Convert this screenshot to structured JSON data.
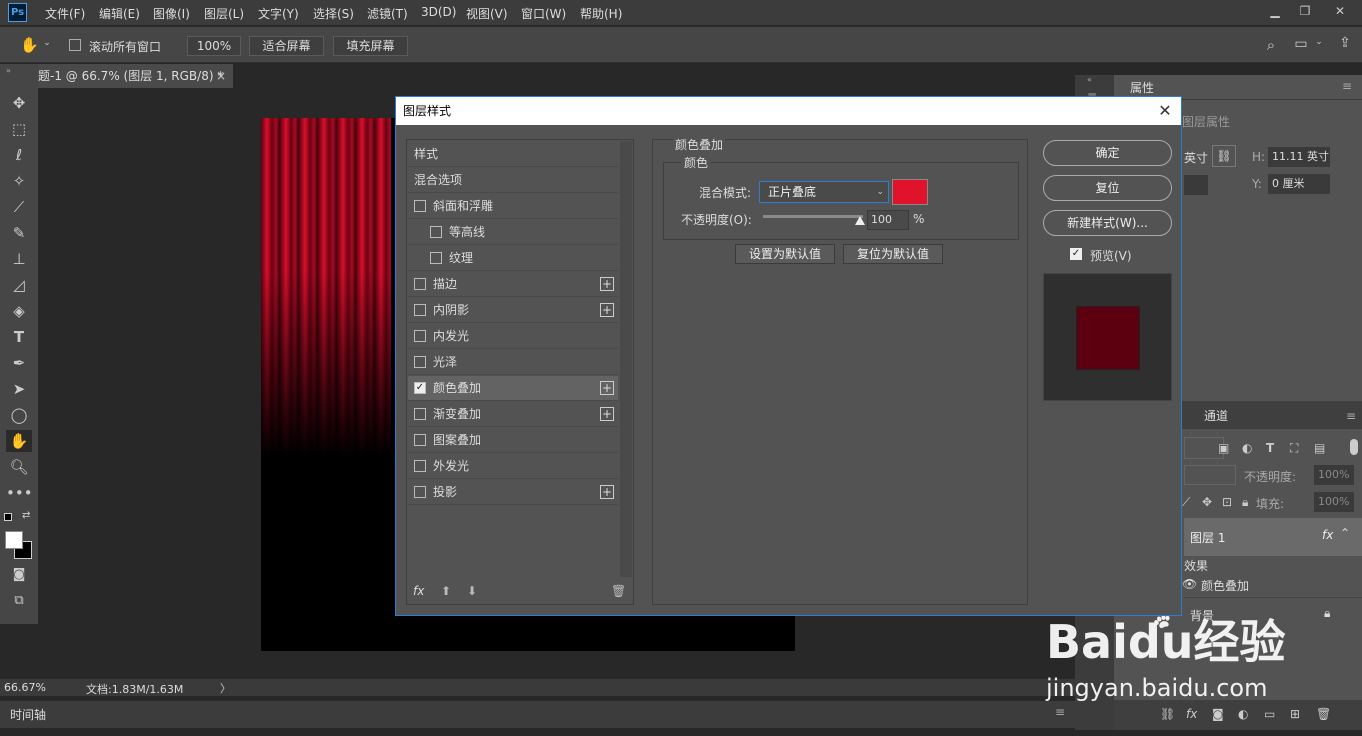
{
  "menubar": {
    "logo": "Ps",
    "items": [
      "文件(F)",
      "编辑(E)",
      "图像(I)",
      "图层(L)",
      "文字(Y)",
      "选择(S)",
      "滤镜(T)",
      "3D(D)",
      "视图(V)",
      "窗口(W)",
      "帮助(H)"
    ]
  },
  "options": {
    "scroll_all": "滚动所有窗口",
    "zoom": "100%",
    "fit_screen": "适合屏幕",
    "fill_screen": "填充屏幕"
  },
  "document": {
    "tab_title": "题-1 @ 66.7% (图层 1, RGB/8) *",
    "tab_close": "×"
  },
  "status": {
    "zoom": "66.67%",
    "doc_info": "文档:1.83M/1.63M",
    "arrow": "〉",
    "timeline": "时间轴"
  },
  "properties": {
    "tab": "属性",
    "subtitle": "图层属性",
    "w_unit": "英寸",
    "h_label": "H:",
    "h_value": "11.11 英寸",
    "y_label": "Y:",
    "y_value": "0 厘米"
  },
  "layers": {
    "tab_channels": "通道",
    "opacity_label": "不透明度:",
    "opacity_value": "100%",
    "fill_label": "填充:",
    "fill_value": "100%",
    "layer1": "图层 1",
    "fx": "fx",
    "effects": "效果",
    "effect_color_overlay": "颜色叠加",
    "background": "背景"
  },
  "dialog": {
    "title": "图层样式",
    "close": "✕",
    "styles": [
      {
        "label": "样式",
        "checkbox": false,
        "plus": false,
        "indent": false,
        "checked": false
      },
      {
        "label": "混合选项",
        "checkbox": false,
        "plus": false,
        "indent": false,
        "checked": false
      },
      {
        "label": "斜面和浮雕",
        "checkbox": true,
        "plus": false,
        "indent": false,
        "checked": false
      },
      {
        "label": "等高线",
        "checkbox": true,
        "plus": false,
        "indent": true,
        "checked": false
      },
      {
        "label": "纹理",
        "checkbox": true,
        "plus": false,
        "indent": true,
        "checked": false
      },
      {
        "label": "描边",
        "checkbox": true,
        "plus": true,
        "indent": false,
        "checked": false
      },
      {
        "label": "内阴影",
        "checkbox": true,
        "plus": true,
        "indent": false,
        "checked": false
      },
      {
        "label": "内发光",
        "checkbox": true,
        "plus": false,
        "indent": false,
        "checked": false
      },
      {
        "label": "光泽",
        "checkbox": true,
        "plus": false,
        "indent": false,
        "checked": false
      },
      {
        "label": "颜色叠加",
        "checkbox": true,
        "plus": true,
        "indent": false,
        "checked": true
      },
      {
        "label": "渐变叠加",
        "checkbox": true,
        "plus": true,
        "indent": false,
        "checked": false
      },
      {
        "label": "图案叠加",
        "checkbox": true,
        "plus": false,
        "indent": false,
        "checked": false
      },
      {
        "label": "外发光",
        "checkbox": true,
        "plus": false,
        "indent": false,
        "checked": false
      },
      {
        "label": "投影",
        "checkbox": true,
        "plus": true,
        "indent": false,
        "checked": false
      }
    ],
    "list_footer": {
      "fx": "fx",
      "up": "⬆",
      "down": "⬇",
      "trash": "🗑"
    },
    "section_title": "颜色叠加",
    "group_title": "颜色",
    "blend_mode_label": "混合模式:",
    "blend_mode_value": "正片叠底",
    "overlay_color": "#e0122c",
    "opacity_label": "不透明度(O):",
    "opacity_value": "100",
    "opacity_percent": 100,
    "percent_sign": "%",
    "set_default": "设置为默认值",
    "reset_default": "复位为默认值",
    "ok": "确定",
    "reset": "复位",
    "new_style": "新建样式(W)...",
    "preview_label": "预览(V)",
    "preview_checked": true,
    "preview_swatch": "#5c0010"
  },
  "watermark": {
    "brand": "Baidu经验",
    "url": "jingyan.baidu.com"
  }
}
